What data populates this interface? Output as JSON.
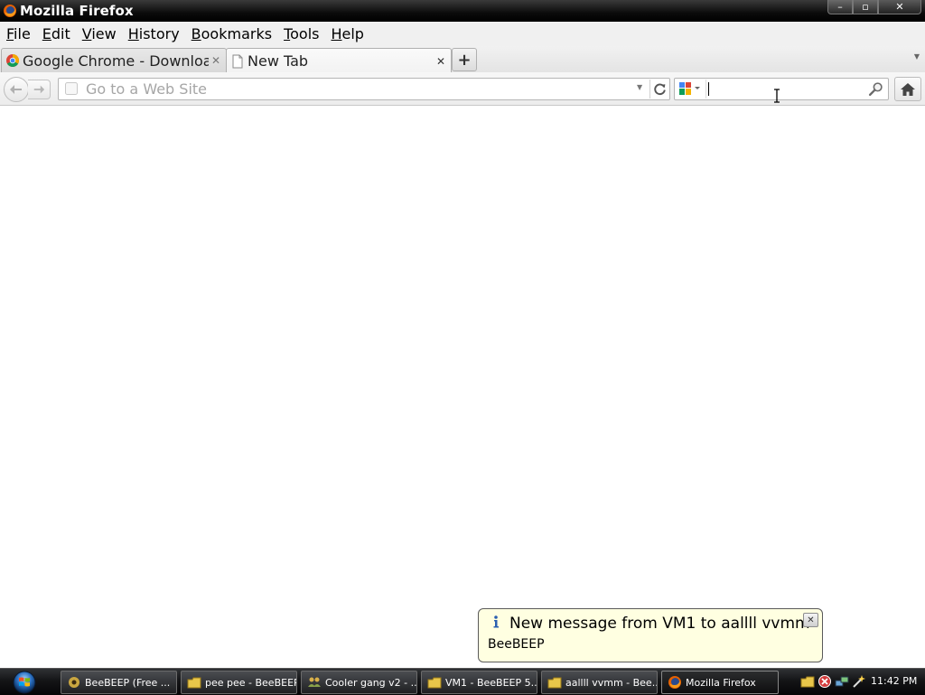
{
  "window": {
    "title": "Mozilla Firefox",
    "controls": {
      "minimize": "–",
      "maximize": "▫",
      "close": "✕"
    }
  },
  "menu": [
    {
      "label": "File",
      "key": "F",
      "rest": "ile"
    },
    {
      "label": "Edit",
      "key": "E",
      "rest": "dit"
    },
    {
      "label": "View",
      "key": "V",
      "rest": "iew"
    },
    {
      "label": "History",
      "key": "H",
      "rest": "istory"
    },
    {
      "label": "Bookmarks",
      "key": "B",
      "rest": "ookmarks"
    },
    {
      "label": "Tools",
      "key": "T",
      "rest": "ools"
    },
    {
      "label": "Help",
      "key": "H",
      "rest": "elp"
    }
  ],
  "tabs": [
    {
      "label": "Google Chrome - Downloa...",
      "icon": "chrome-icon",
      "active": false,
      "close": "✕"
    },
    {
      "label": "New Tab",
      "icon": "page-icon",
      "active": true,
      "close": "✕"
    }
  ],
  "new_tab_label": "+",
  "urlbar": {
    "placeholder": "Go to a Web Site",
    "value": ""
  },
  "searchbar": {
    "engine": "google-icon",
    "value": ""
  },
  "notification": {
    "title": "New message from VM1 to aallll vvmm",
    "body": "BeeBEEP",
    "close": "✕"
  },
  "taskbar": {
    "items": [
      {
        "label": "BeeBEEP (Free ...",
        "icon": "beebeep-gear-icon",
        "active": false
      },
      {
        "label": "pee pee - BeeBEEP",
        "icon": "beebeep-folder-icon",
        "active": false
      },
      {
        "label": "Cooler gang v2 - ...",
        "icon": "group-icon",
        "active": false
      },
      {
        "label": "VM1 - BeeBEEP 5....",
        "icon": "beebeep-folder-icon",
        "active": false
      },
      {
        "label": "aallll vvmm - Bee...",
        "icon": "beebeep-folder-icon",
        "active": false
      },
      {
        "label": "Mozilla Firefox",
        "icon": "firefox-icon",
        "active": true
      }
    ],
    "clock": "11:42 PM"
  },
  "colors": {
    "balloon_bg": "#ffffe1",
    "titlebar": "#000000",
    "taskbar": "#141517"
  }
}
